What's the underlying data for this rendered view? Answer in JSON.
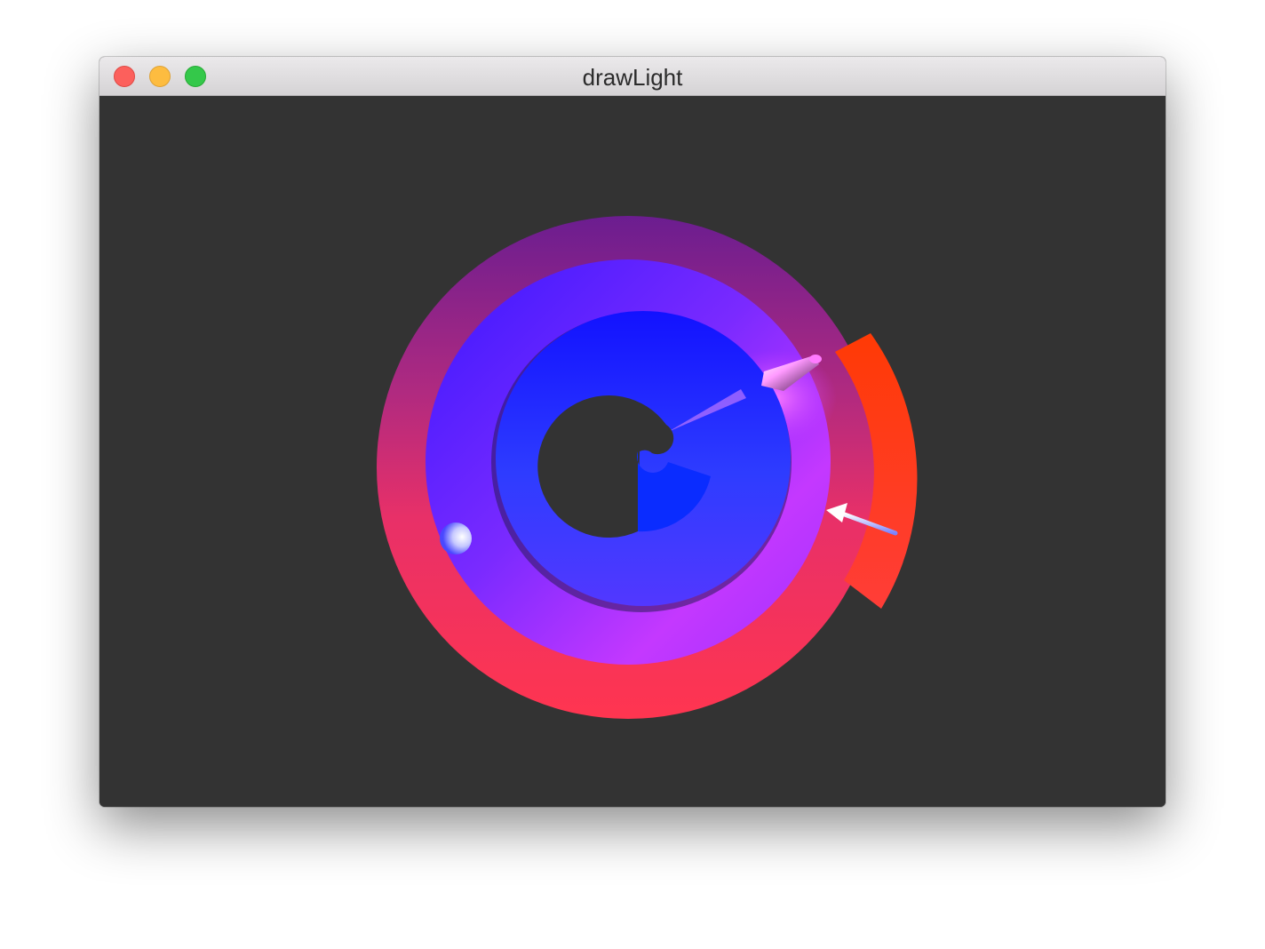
{
  "window": {
    "title": "drawLight"
  },
  "colors": {
    "background": "#333333",
    "outer_ring_top": "#6e1f8f",
    "outer_ring_bottom": "#ff3456",
    "outer_tail": "#ff3a10",
    "middle_ring": "#a535ff",
    "inner_ring": "#1020ff"
  },
  "scene": {
    "objects": [
      "spiral-ring",
      "point-light-sphere",
      "spot-light-cone",
      "directional-light-arrow"
    ]
  }
}
